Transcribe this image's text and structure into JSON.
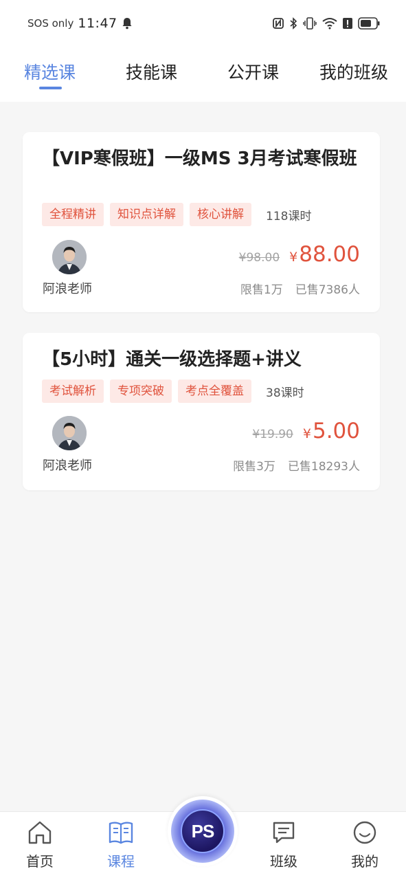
{
  "status_bar": {
    "carrier": "SOS only",
    "time": "11:47",
    "icons": [
      "bell-icon",
      "nfc-icon",
      "bluetooth-icon",
      "vibrate-icon",
      "wifi-icon",
      "alert-icon",
      "battery-icon"
    ]
  },
  "tabs": [
    {
      "label": "精选课",
      "active": true
    },
    {
      "label": "技能课",
      "active": false
    },
    {
      "label": "公开课",
      "active": false
    },
    {
      "label": "我的班级",
      "active": false
    }
  ],
  "courses": [
    {
      "title": "【VIP寒假班】一级MS 3月考试寒假班",
      "tags": [
        "全程精讲",
        "知识点详解",
        "核心讲解"
      ],
      "lessons": "118课时",
      "teacher": "阿浪老师",
      "original_price": "¥98.00",
      "price_symbol": "¥",
      "price": "88.00",
      "limit": "限售1万",
      "sold": "已售7386人"
    },
    {
      "title": "【5小时】通关一级选择题+讲义",
      "tags": [
        "考试解析",
        "专项突破",
        "考点全覆盖"
      ],
      "lessons": "38课时",
      "teacher": "阿浪老师",
      "original_price": "¥19.90",
      "price_symbol": "¥",
      "price": "5.00",
      "limit": "限售3万",
      "sold": "已售18293人"
    }
  ],
  "bottom_nav": {
    "items": [
      {
        "label": "首页",
        "icon": "home-icon",
        "active": false
      },
      {
        "label": "课程",
        "icon": "book-icon",
        "active": true
      },
      {
        "label": "班级",
        "icon": "message-icon",
        "active": false
      },
      {
        "label": "我的",
        "icon": "smile-icon",
        "active": false
      }
    ],
    "center_label": "PS"
  },
  "colors": {
    "accent": "#5a86e0",
    "price": "#e0533d",
    "tag_bg": "#fde9e6",
    "background": "#f6f6f6"
  }
}
